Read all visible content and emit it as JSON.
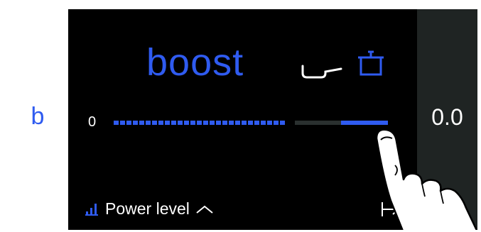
{
  "left_panel": {
    "letter": "b"
  },
  "mode": {
    "title": "boost"
  },
  "icons": {
    "pan": "frying-pan-icon",
    "pot": "cooking-pot-icon",
    "power": "signal-bars-icon",
    "chevron": "chevron-up-icon",
    "jump": "jump-to-end-icon"
  },
  "slider": {
    "min_label": "0",
    "level_fraction": 0.92
  },
  "right_panel": {
    "value": "0.0"
  },
  "bottom": {
    "power_label": "Power level"
  },
  "colors": {
    "accent": "#2f5bf0",
    "background": "#000000",
    "right_panel": "#1f2423"
  }
}
